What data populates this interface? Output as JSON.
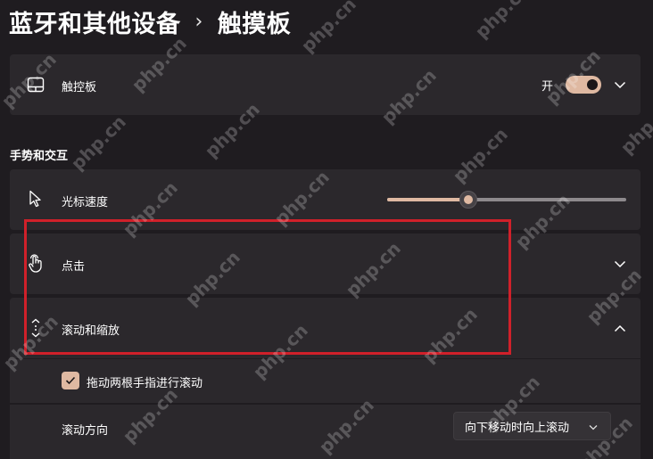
{
  "breadcrumb": {
    "parent": "蓝牙和其他设备",
    "separator": "›",
    "current": "触摸板"
  },
  "touchpad_row": {
    "label": "触控板",
    "toggle_state_text": "开",
    "toggle_on": true,
    "icon": "touchpad-icon"
  },
  "section_title": "手势和交互",
  "pointer_speed": {
    "label": "光标速度",
    "icon": "cursor-icon",
    "value_fraction": 0.34
  },
  "taps": {
    "label": "点击",
    "icon": "tap-hand-icon"
  },
  "scroll_zoom": {
    "label": "滚动和缩放",
    "icon": "scroll-arrows-icon",
    "expanded": true,
    "two_finger_drag": {
      "label": "拖动两根手指进行滚动",
      "checked": true
    },
    "scroll_direction": {
      "label": "滚动方向",
      "value": "向下移动时向上滚动"
    }
  },
  "watermark": "php.cn",
  "colors": {
    "accent": "#dfb9a2",
    "card": "#2b282c",
    "background": "#1f1c20",
    "highlight": "#d0202a"
  }
}
